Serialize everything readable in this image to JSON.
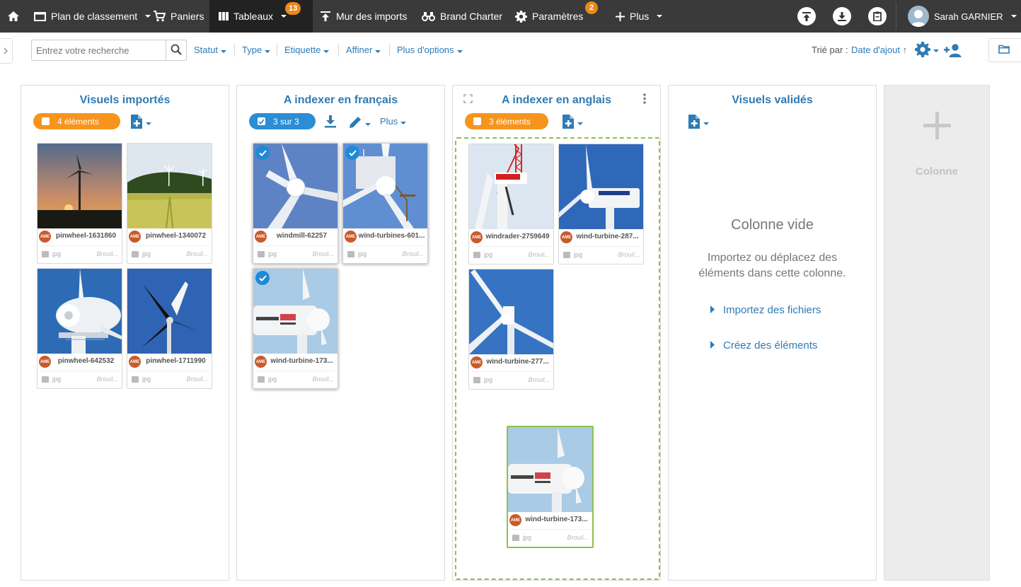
{
  "nav": {
    "plan": "Plan de classement",
    "paniers": "Paniers",
    "tableaux": "Tableaux",
    "tableaux_badge": "13",
    "mur": "Mur des imports",
    "brand": "Brand Charter",
    "parametres": "Paramètres",
    "parametres_badge": "2",
    "plus": "Plus",
    "user": "Sarah GARNIER"
  },
  "filters": {
    "search_placeholder": "Entrez votre recherche",
    "statut": "Statut",
    "type": "Type",
    "etiquette": "Etiquette",
    "affiner": "Affiner",
    "options": "Plus d'options",
    "sort_label": "Trié par :",
    "sort_value": "Date d'ajout ↑"
  },
  "columns": [
    {
      "title": "Visuels importés",
      "count": "4 éléments",
      "cards": [
        {
          "name": "pinwheel-1631860",
          "type": "jpg",
          "status": "Brouil...",
          "avatar": "AME"
        },
        {
          "name": "pinwheel-1340072",
          "type": "jpg",
          "status": "Brouil...",
          "avatar": "AME"
        },
        {
          "name": "pinwheel-642532",
          "type": "jpg",
          "status": "Brouil...",
          "avatar": "AME"
        },
        {
          "name": "pinwheel-1711990",
          "type": "jpg",
          "status": "Brouil...",
          "avatar": "AME"
        }
      ]
    },
    {
      "title": "A indexer en français",
      "count": "3 sur 3",
      "plus": "Plus",
      "cards": [
        {
          "name": "windmill-62257",
          "type": "jpg",
          "status": "Brouil...",
          "avatar": "AME"
        },
        {
          "name": "wind-turbines-601...",
          "type": "jpg",
          "status": "Brouil...",
          "avatar": "AME"
        },
        {
          "name": "wind-turbine-173...",
          "type": "jpg",
          "status": "Brouil...",
          "avatar": "AME"
        }
      ]
    },
    {
      "title": "A indexer en anglais",
      "count": "3 éléments",
      "cards": [
        {
          "name": "windrader-2759649",
          "type": "jpg",
          "status": "Brouil...",
          "avatar": "AME"
        },
        {
          "name": "wind-turbine-287...",
          "type": "jpg",
          "status": "Brouil...",
          "avatar": "AME"
        },
        {
          "name": "wind-turbine-277...",
          "type": "jpg",
          "status": "Brouil...",
          "avatar": "AME"
        }
      ],
      "dragging": {
        "name": "wind-turbine-173...",
        "type": "jpg",
        "status": "Brouil...",
        "avatar": "AME"
      }
    },
    {
      "title": "Visuels validés",
      "empty_title": "Colonne vide",
      "empty_text": "Importez ou déplacez des éléments dans cette colonne.",
      "link_import": "Importez des fichiers",
      "link_create": "Créez des éléments"
    }
  ],
  "new_column": "Colonne",
  "colors": {
    "nav_bg": "#3a3a3a",
    "accent_blue": "#2e7bb5",
    "orange": "#f7941d",
    "badge": "#e8891c",
    "drop_zone": "#8bc34a"
  }
}
